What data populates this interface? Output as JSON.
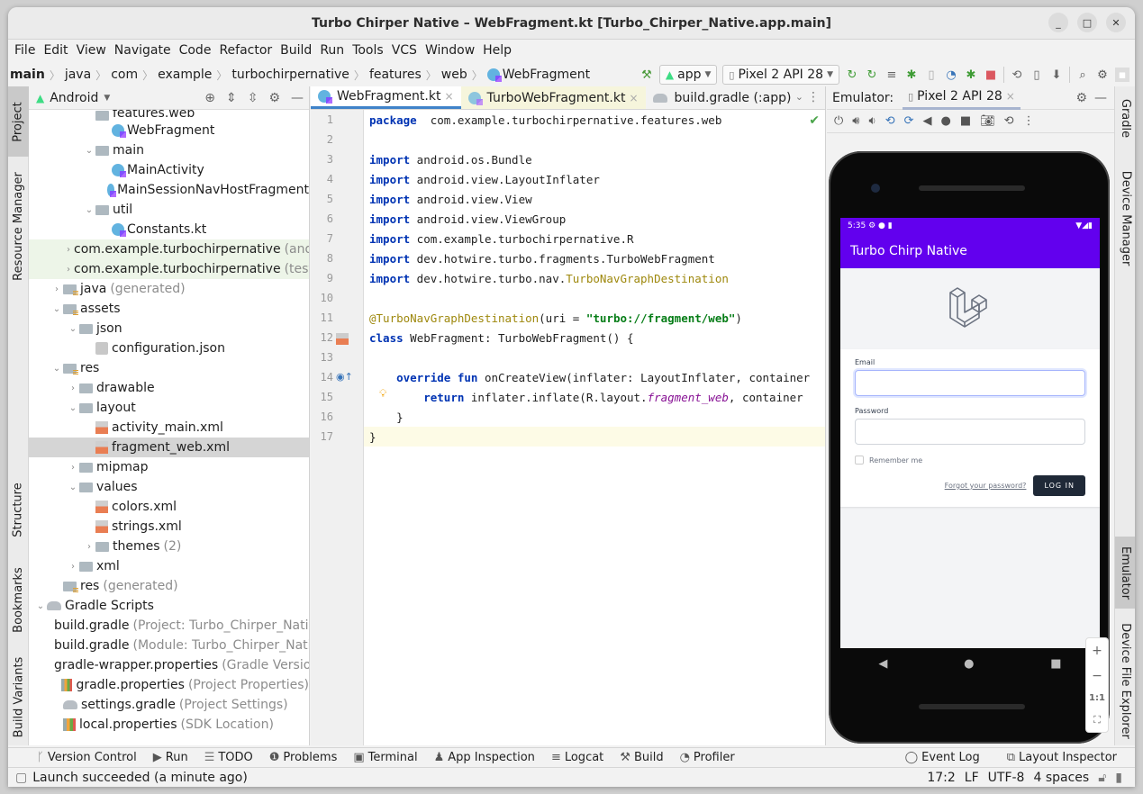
{
  "window": {
    "title": "Turbo Chirper Native – WebFragment.kt [Turbo_Chirper_Native.app.main]",
    "controls": [
      "minimize",
      "maximize",
      "close"
    ]
  },
  "menu": [
    "File",
    "Edit",
    "View",
    "Navigate",
    "Code",
    "Refactor",
    "Build",
    "Run",
    "Tools",
    "VCS",
    "Window",
    "Help"
  ],
  "breadcrumb": [
    "main",
    "java",
    "com",
    "example",
    "turbochirpernative",
    "features",
    "web",
    "WebFragment"
  ],
  "toolbar": {
    "run_config": "app",
    "device": "Pixel 2 API 28"
  },
  "left_tool_tabs": [
    "Project",
    "Resource Manager",
    "Structure",
    "Bookmarks",
    "Build Variants"
  ],
  "right_tool_tabs": [
    "Gradle",
    "Device Manager",
    "Emulator",
    "Device File Explorer"
  ],
  "project": {
    "view": "Android",
    "tree": [
      {
        "label": "features.web",
        "depth": 3,
        "type": "folder",
        "partial": true
      },
      {
        "label": "WebFragment",
        "depth": 4,
        "type": "kotlin"
      },
      {
        "label": "main",
        "depth": 3,
        "type": "folder",
        "expanded": true
      },
      {
        "label": "MainActivity",
        "depth": 4,
        "type": "kotlin"
      },
      {
        "label": "MainSessionNavHostFragment",
        "depth": 4,
        "type": "kotlin"
      },
      {
        "label": "util",
        "depth": 3,
        "type": "folder",
        "expanded": true
      },
      {
        "label": "Constants.kt",
        "depth": 4,
        "type": "kotlin-file"
      },
      {
        "label": "com.example.turbochirpernative",
        "suffix": "(androidTest)",
        "depth": 2,
        "type": "folder",
        "collapsed": true,
        "highlight": true
      },
      {
        "label": "com.example.turbochirpernative",
        "suffix": "(test)",
        "depth": 2,
        "type": "folder",
        "collapsed": true,
        "highlight": true
      },
      {
        "label": "java",
        "suffix": "(generated)",
        "depth": 1,
        "type": "gen-folder",
        "collapsed": true
      },
      {
        "label": "assets",
        "depth": 1,
        "type": "res-folder",
        "expanded": true
      },
      {
        "label": "json",
        "depth": 2,
        "type": "folder",
        "expanded": true
      },
      {
        "label": "configuration.json",
        "depth": 3,
        "type": "json"
      },
      {
        "label": "res",
        "depth": 1,
        "type": "res-folder",
        "expanded": true
      },
      {
        "label": "drawable",
        "depth": 2,
        "type": "folder",
        "collapsed": true
      },
      {
        "label": "layout",
        "depth": 2,
        "type": "folder",
        "expanded": true
      },
      {
        "label": "activity_main.xml",
        "depth": 3,
        "type": "xml"
      },
      {
        "label": "fragment_web.xml",
        "depth": 3,
        "type": "xml",
        "selected": true
      },
      {
        "label": "mipmap",
        "depth": 2,
        "type": "folder",
        "collapsed": true
      },
      {
        "label": "values",
        "depth": 2,
        "type": "folder",
        "expanded": true
      },
      {
        "label": "colors.xml",
        "depth": 3,
        "type": "xml"
      },
      {
        "label": "strings.xml",
        "depth": 3,
        "type": "xml"
      },
      {
        "label": "themes",
        "suffix": "(2)",
        "depth": 3,
        "type": "folder",
        "collapsed": true
      },
      {
        "label": "xml",
        "depth": 2,
        "type": "folder",
        "collapsed": true
      },
      {
        "label": "res",
        "suffix": "(generated)",
        "depth": 1,
        "type": "res-folder"
      },
      {
        "label": "Gradle Scripts",
        "depth": 0,
        "type": "gradle",
        "expanded": true
      },
      {
        "label": "build.gradle",
        "suffix": "(Project: Turbo_Chirper_Native)",
        "depth": 1,
        "type": "gradle"
      },
      {
        "label": "build.gradle",
        "suffix": "(Module: Turbo_Chirper_Native.app)",
        "depth": 1,
        "type": "gradle"
      },
      {
        "label": "gradle-wrapper.properties",
        "suffix": "(Gradle Version)",
        "depth": 1,
        "type": "props"
      },
      {
        "label": "gradle.properties",
        "suffix": "(Project Properties)",
        "depth": 1,
        "type": "props"
      },
      {
        "label": "settings.gradle",
        "suffix": "(Project Settings)",
        "depth": 1,
        "type": "gradle"
      },
      {
        "label": "local.properties",
        "suffix": "(SDK Location)",
        "depth": 1,
        "type": "props"
      }
    ]
  },
  "editor": {
    "tabs": [
      {
        "label": "WebFragment.kt",
        "active": true
      },
      {
        "label": "TurboWebFragment.kt",
        "active": false
      },
      {
        "label": "build.gradle (:app)",
        "active": false
      }
    ],
    "lines": [
      {
        "n": "1",
        "tokens": [
          [
            "kw",
            "package"
          ],
          [
            "",
            "  com.example.turbochirpernative.features.web"
          ]
        ]
      },
      {
        "n": "2",
        "tokens": []
      },
      {
        "n": "3",
        "tokens": [
          [
            "kw",
            "import"
          ],
          [
            "",
            " android.os.Bundle"
          ]
        ]
      },
      {
        "n": "4",
        "tokens": [
          [
            "kw",
            "import"
          ],
          [
            "",
            " android.view.LayoutInflater"
          ]
        ]
      },
      {
        "n": "5",
        "tokens": [
          [
            "kw",
            "import"
          ],
          [
            "",
            " android.view.View"
          ]
        ]
      },
      {
        "n": "6",
        "tokens": [
          [
            "kw",
            "import"
          ],
          [
            "",
            " android.view.ViewGroup"
          ]
        ]
      },
      {
        "n": "7",
        "tokens": [
          [
            "kw",
            "import"
          ],
          [
            "",
            " com.example.turbochirpernative.R"
          ]
        ]
      },
      {
        "n": "8",
        "tokens": [
          [
            "kw",
            "import"
          ],
          [
            "",
            " dev.hotwire.turbo.fragments.TurboWebFragment"
          ]
        ]
      },
      {
        "n": "9",
        "tokens": [
          [
            "kw",
            "import"
          ],
          [
            "",
            " dev.hotwire.turbo.nav."
          ],
          [
            "ann",
            "TurboNavGraphDestination"
          ]
        ]
      },
      {
        "n": "10",
        "tokens": []
      },
      {
        "n": "11",
        "tokens": [
          [
            "ann",
            "@TurboNavGraphDestination"
          ],
          [
            "",
            "(uri = "
          ],
          [
            "str",
            "\"turbo://fragment/web\""
          ],
          [
            "",
            ")"
          ]
        ]
      },
      {
        "n": "12",
        "tokens": [
          [
            "kw",
            "class"
          ],
          [
            "",
            " WebFragment: TurboWebFragment() {"
          ]
        ]
      },
      {
        "n": "13",
        "tokens": []
      },
      {
        "n": "14",
        "tokens": [
          [
            "",
            "    "
          ],
          [
            "kw",
            "override fun"
          ],
          [
            "",
            " onCreateView(inflater: LayoutInflater, container"
          ]
        ]
      },
      {
        "n": "15",
        "tokens": [
          [
            "",
            "        "
          ],
          [
            "kw",
            "return"
          ],
          [
            "",
            " inflater.inflate(R.layout."
          ],
          [
            "it",
            "fragment_web"
          ],
          [
            "",
            ", container"
          ]
        ]
      },
      {
        "n": "16",
        "tokens": [
          [
            "",
            "    }"
          ]
        ]
      },
      {
        "n": "17",
        "tokens": [
          [
            "",
            "}"
          ]
        ],
        "current": true
      }
    ]
  },
  "emulator": {
    "label": "Emulator:",
    "device_tab": "Pixel 2 API 28",
    "zoom_controls": [
      "+",
      "−",
      "1:1"
    ],
    "phone": {
      "status_time": "5:35",
      "app_title": "Turbo Chirp Native",
      "app_bar_color": "#6200ee",
      "form": {
        "email_label": "Email",
        "email_value": "",
        "password_label": "Password",
        "password_value": "",
        "remember_label": "Remember me",
        "remember_checked": false,
        "forgot_link": "Forgot your password?",
        "login_button": "LOG IN"
      }
    }
  },
  "bottom_tools": {
    "left": [
      "Version Control",
      "Run",
      "TODO",
      "Problems",
      "Terminal",
      "App Inspection",
      "Logcat",
      "Build",
      "Profiler"
    ],
    "right": [
      "Event Log",
      "Layout Inspector"
    ]
  },
  "status_bar": {
    "message": "Launch succeeded (a minute ago)",
    "position": "17:2",
    "line_sep": "LF",
    "encoding": "UTF-8",
    "indent": "4 spaces"
  }
}
